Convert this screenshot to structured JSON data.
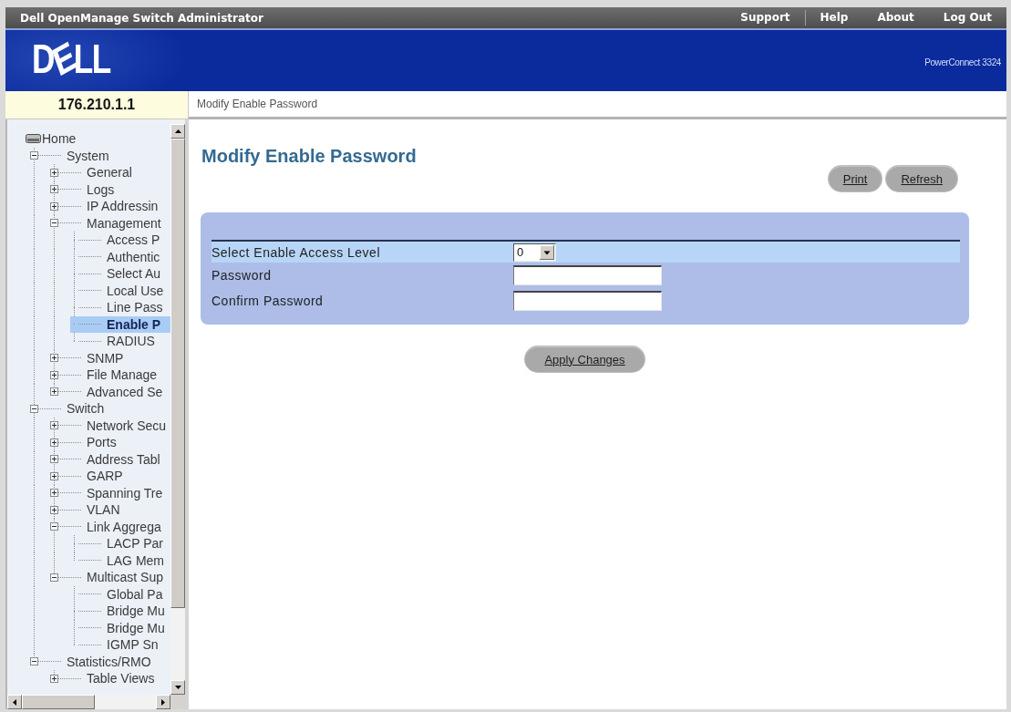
{
  "window": {
    "title": "Dell OpenManage Switch Administrator",
    "links": [
      "Support",
      "Help",
      "About",
      "Log Out"
    ]
  },
  "banner": {
    "logo": "DELL",
    "product": "PowerConnect 3324"
  },
  "device": {
    "address": "176.210.1.1"
  },
  "breadcrumb": "Modify Enable Password",
  "tree": [
    {
      "label": "Home",
      "kind": "root",
      "selected": false,
      "children": [
        {
          "label": "System",
          "kind": "branch",
          "expanded": true,
          "selected": false,
          "children": [
            {
              "label": "General",
              "kind": "branch",
              "expanded": false,
              "selected": false
            },
            {
              "label": "Logs",
              "kind": "branch",
              "expanded": false,
              "selected": false
            },
            {
              "label": "IP Addressin",
              "kind": "branch",
              "expanded": false,
              "selected": false
            },
            {
              "label": "Management",
              "kind": "branch",
              "expanded": true,
              "selected": false,
              "children": [
                {
                  "label": "Access P",
                  "kind": "leaf",
                  "selected": false
                },
                {
                  "label": "Authentic",
                  "kind": "leaf",
                  "selected": false
                },
                {
                  "label": "Select Au",
                  "kind": "leaf",
                  "selected": false
                },
                {
                  "label": "Local Use",
                  "kind": "leaf",
                  "selected": false
                },
                {
                  "label": "Line Pass",
                  "kind": "leaf",
                  "selected": false
                },
                {
                  "label": "Enable P",
                  "kind": "leaf",
                  "selected": true
                },
                {
                  "label": "RADIUS",
                  "kind": "leaf",
                  "selected": false
                }
              ]
            },
            {
              "label": "SNMP",
              "kind": "branch",
              "expanded": false,
              "selected": false
            },
            {
              "label": "File Manage",
              "kind": "branch",
              "expanded": false,
              "selected": false
            },
            {
              "label": "Advanced Se",
              "kind": "branch",
              "expanded": false,
              "selected": false
            }
          ]
        },
        {
          "label": "Switch",
          "kind": "branch",
          "expanded": true,
          "selected": false,
          "children": [
            {
              "label": "Network Secu",
              "kind": "branch",
              "expanded": false,
              "selected": false
            },
            {
              "label": "Ports",
              "kind": "branch",
              "expanded": false,
              "selected": false
            },
            {
              "label": "Address Tabl",
              "kind": "branch",
              "expanded": false,
              "selected": false
            },
            {
              "label": "GARP",
              "kind": "branch",
              "expanded": false,
              "selected": false
            },
            {
              "label": "Spanning Tre",
              "kind": "branch",
              "expanded": false,
              "selected": false
            },
            {
              "label": "VLAN",
              "kind": "branch",
              "expanded": false,
              "selected": false
            },
            {
              "label": "Link Aggrega",
              "kind": "branch",
              "expanded": true,
              "selected": false,
              "children": [
                {
                  "label": "LACP Par",
                  "kind": "leaf",
                  "selected": false
                },
                {
                  "label": "LAG Mem",
                  "kind": "leaf",
                  "selected": false
                }
              ]
            },
            {
              "label": "Multicast Sup",
              "kind": "branch",
              "expanded": true,
              "selected": false,
              "children": [
                {
                  "label": "Global Pa",
                  "kind": "leaf",
                  "selected": false
                },
                {
                  "label": "Bridge Mu",
                  "kind": "leaf",
                  "selected": false
                },
                {
                  "label": "Bridge Mu",
                  "kind": "leaf",
                  "selected": false
                },
                {
                  "label": "IGMP Sn",
                  "kind": "leaf",
                  "selected": false
                }
              ]
            }
          ]
        },
        {
          "label": "Statistics/RMO",
          "kind": "branch",
          "expanded": true,
          "selected": false,
          "children": [
            {
              "label": "Table Views",
              "kind": "branch",
              "expanded": false,
              "selected": false
            }
          ]
        }
      ]
    }
  ],
  "page": {
    "title": "Modify Enable Password",
    "buttons": [
      "Print",
      "Refresh"
    ],
    "form": {
      "rows": [
        {
          "label": "Select Enable Access Level",
          "kind": "select",
          "value": "0",
          "highlighted": true
        },
        {
          "label": "Password",
          "kind": "password",
          "highlighted": false
        },
        {
          "label": "Confirm Password",
          "kind": "password",
          "highlighted": false
        }
      ]
    },
    "apply_button": "Apply Changes"
  }
}
